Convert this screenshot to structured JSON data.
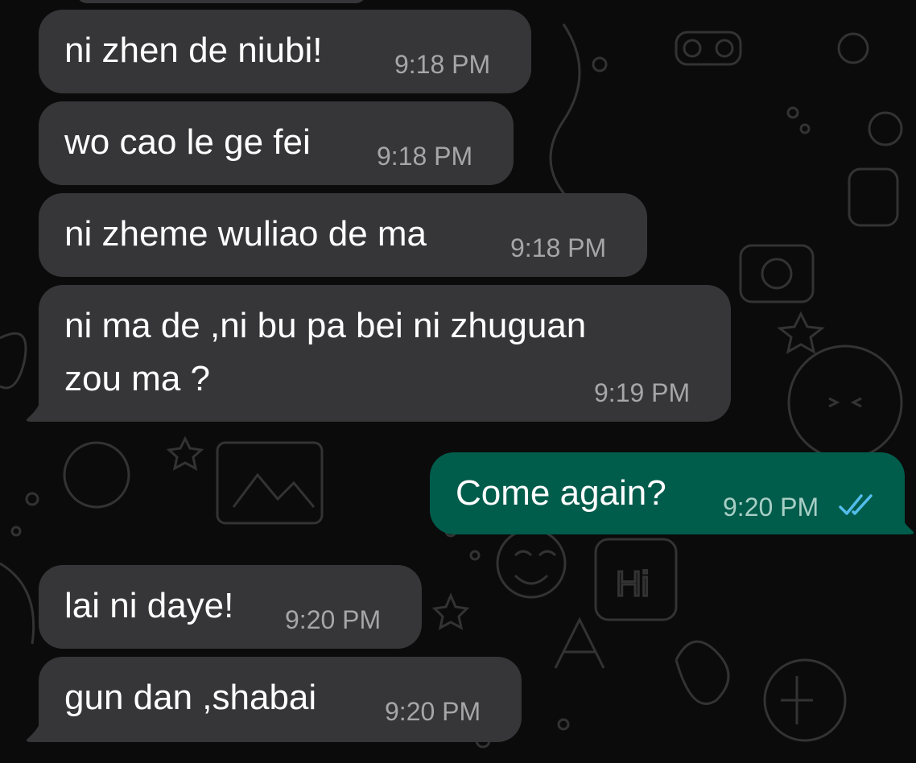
{
  "conversation": {
    "messages": [
      {
        "direction": "incoming",
        "text": "ni zhen de niubi!",
        "time": "9:18 PM"
      },
      {
        "direction": "incoming",
        "text": "wo cao le ge fei",
        "time": "9:18 PM"
      },
      {
        "direction": "incoming",
        "text": "ni zheme wuliao de ma",
        "time": "9:18 PM"
      },
      {
        "direction": "incoming",
        "text_line1": "ni ma de ,ni bu pa bei ni zhuguan",
        "text_line2": "zou ma ?",
        "time": "9:19 PM"
      },
      {
        "direction": "outgoing",
        "text": "Come again?",
        "time": "9:20 PM",
        "status": "read"
      },
      {
        "direction": "incoming",
        "text": "lai ni daye!",
        "time": "9:20 PM"
      },
      {
        "direction": "incoming",
        "text": "gun dan ,shabai",
        "time": "9:20 PM"
      }
    ]
  },
  "wallpaper": {
    "doodle_label": "Hi"
  },
  "icons": {
    "read_receipt": "double-check-icon"
  },
  "colors": {
    "background": "#0b0b0b",
    "incoming_bubble": "#363638",
    "outgoing_bubble": "#005c4b",
    "timestamp_incoming": "#a6a6aa",
    "timestamp_outgoing": "#a8cfc6",
    "read_tick": "#53bdeb",
    "message_text": "#ffffff"
  }
}
